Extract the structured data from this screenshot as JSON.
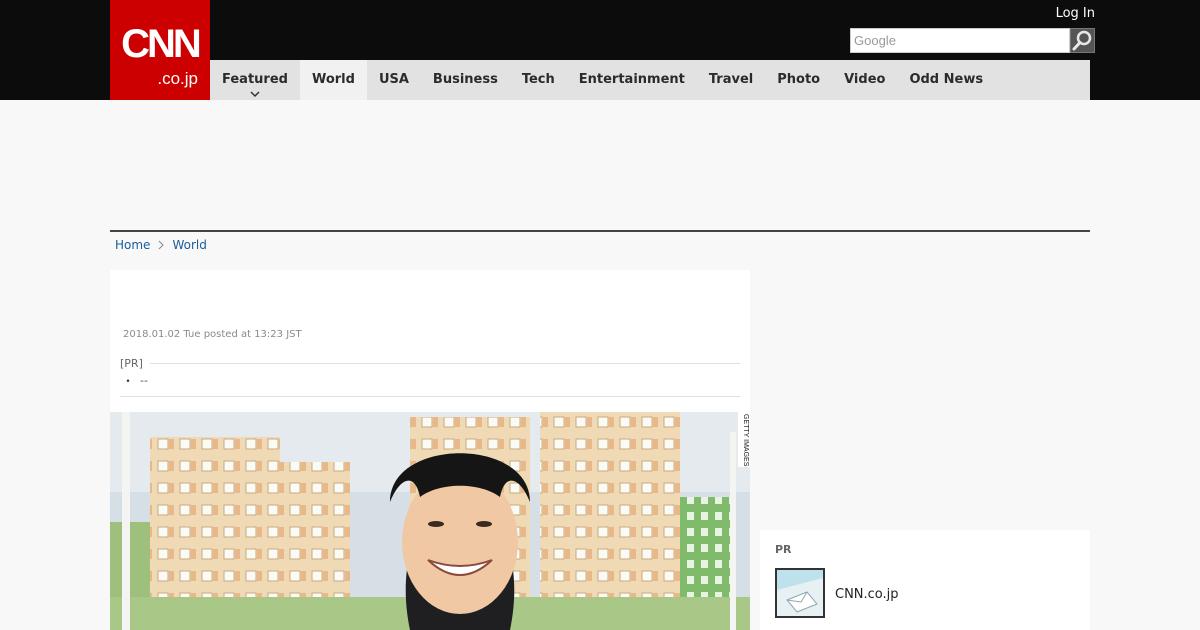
{
  "header": {
    "logo_main": "CNN",
    "logo_sub": ".co.jp",
    "login_label": "Log In",
    "search_placeholder": "Google",
    "search_icon": "magnifier-icon",
    "brand_color": "#cc0000"
  },
  "nav": {
    "items": [
      {
        "label": "Featured",
        "has_dropdown": true
      },
      {
        "label": "World",
        "active": true
      },
      {
        "label": "USA"
      },
      {
        "label": "Business"
      },
      {
        "label": "Tech"
      },
      {
        "label": "Entertainment"
      },
      {
        "label": "Travel"
      },
      {
        "label": "Photo"
      },
      {
        "label": "Video"
      },
      {
        "label": "Odd News"
      }
    ]
  },
  "breadcrumb": {
    "items": [
      "Home",
      "World"
    ]
  },
  "article": {
    "posted": "2018.01.02 Tue posted at 13:23 JST",
    "pr_label": "[PR]",
    "pr_bullet": "・",
    "pr_link": "--",
    "photo_credit": "GETTY IMAGES"
  },
  "sidebar": {
    "pr_label": "PR",
    "pr_item_text": "CNN.co.jp"
  }
}
